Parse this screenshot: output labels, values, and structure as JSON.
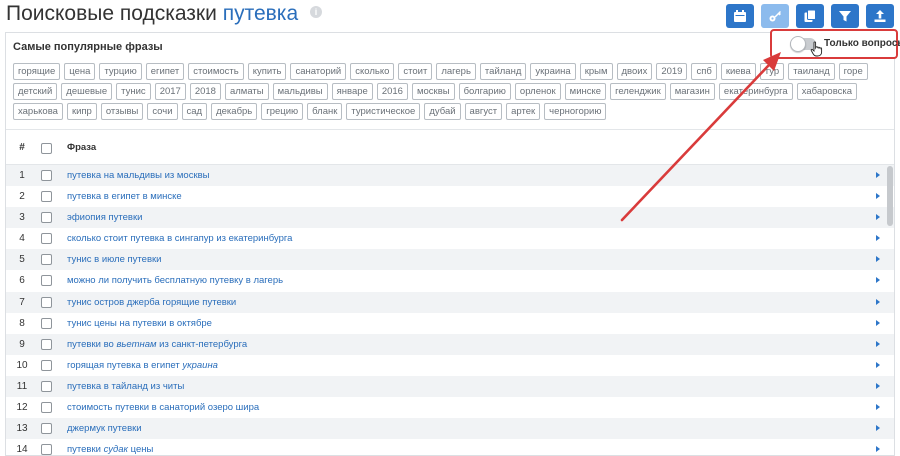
{
  "header": {
    "title_prefix": "Поисковые подсказки",
    "keyword": "путевка",
    "info_glyph": "i",
    "toolbar": [
      {
        "name": "calendar-button",
        "icon": "calendar-icon"
      },
      {
        "name": "key-button",
        "icon": "key-icon"
      },
      {
        "name": "copy-button",
        "icon": "copy-icon"
      },
      {
        "name": "filter-button",
        "icon": "filter-icon"
      },
      {
        "name": "export-button",
        "icon": "upload-icon"
      }
    ]
  },
  "popular": {
    "title": "Самые популярные фразы",
    "tags": [
      "горящие",
      "цена",
      "турцию",
      "египет",
      "стоимость",
      "купить",
      "санаторий",
      "сколько",
      "стоит",
      "лагерь",
      "тайланд",
      "украина",
      "крым",
      "двоих",
      "2019",
      "спб",
      "киева",
      "тур",
      "таиланд",
      "горе",
      "детский",
      "дешевые",
      "тунис",
      "2017",
      "2018",
      "алматы",
      "мальдивы",
      "январе",
      "2016",
      "москвы",
      "болгарию",
      "орленок",
      "минске",
      "геленджик",
      "магазин",
      "екатеринбурга",
      "хабаровска",
      "харькова",
      "кипр",
      "отзывы",
      "сочи",
      "сад",
      "декабрь",
      "грецию",
      "бланк",
      "туристическое",
      "дубай",
      "август",
      "артек",
      "черногорию"
    ]
  },
  "toggle": {
    "label": "Только вопросы",
    "on": false
  },
  "table": {
    "col_num": "#",
    "col_phrase": "Фраза",
    "rows": [
      {
        "num": "1",
        "parts": [
          {
            "t": "путевка на мальдивы из москвы"
          }
        ]
      },
      {
        "num": "2",
        "parts": [
          {
            "t": "путевка в египет в минске"
          }
        ]
      },
      {
        "num": "3",
        "parts": [
          {
            "t": "эфиопия путевки"
          }
        ]
      },
      {
        "num": "4",
        "parts": [
          {
            "t": "сколько стоит путевка в сингапур из екатеринбурга"
          }
        ]
      },
      {
        "num": "5",
        "parts": [
          {
            "t": "тунис в июле путевки"
          }
        ]
      },
      {
        "num": "6",
        "parts": [
          {
            "t": "можно ли получить бесплатную путевку в лагерь"
          }
        ]
      },
      {
        "num": "7",
        "parts": [
          {
            "t": "тунис остров джерба горящие путевки"
          }
        ]
      },
      {
        "num": "8",
        "parts": [
          {
            "t": "тунис цены на путевки в октябре"
          }
        ]
      },
      {
        "num": "9",
        "parts": [
          {
            "t": "путевки во "
          },
          {
            "t": "вьетнам",
            "i": true
          },
          {
            "t": " из санкт-петербурга"
          }
        ]
      },
      {
        "num": "10",
        "parts": [
          {
            "t": "горящая путевка в египет "
          },
          {
            "t": "украина",
            "i": true
          }
        ]
      },
      {
        "num": "11",
        "parts": [
          {
            "t": "путевка в тайланд из читы"
          }
        ]
      },
      {
        "num": "12",
        "parts": [
          {
            "t": "стоимость путевки в санаторий озеро шира"
          }
        ]
      },
      {
        "num": "13",
        "parts": [
          {
            "t": "джермук путевки"
          }
        ]
      },
      {
        "num": "14",
        "parts": [
          {
            "t": "путевки "
          },
          {
            "t": "судак",
            "i": true
          },
          {
            "t": " цены"
          }
        ]
      }
    ]
  },
  "colors": {
    "accent": "#2d76c9",
    "accent_light": "#8cbbed",
    "link": "#2a6ebb",
    "annotation": "#d93b3b"
  }
}
